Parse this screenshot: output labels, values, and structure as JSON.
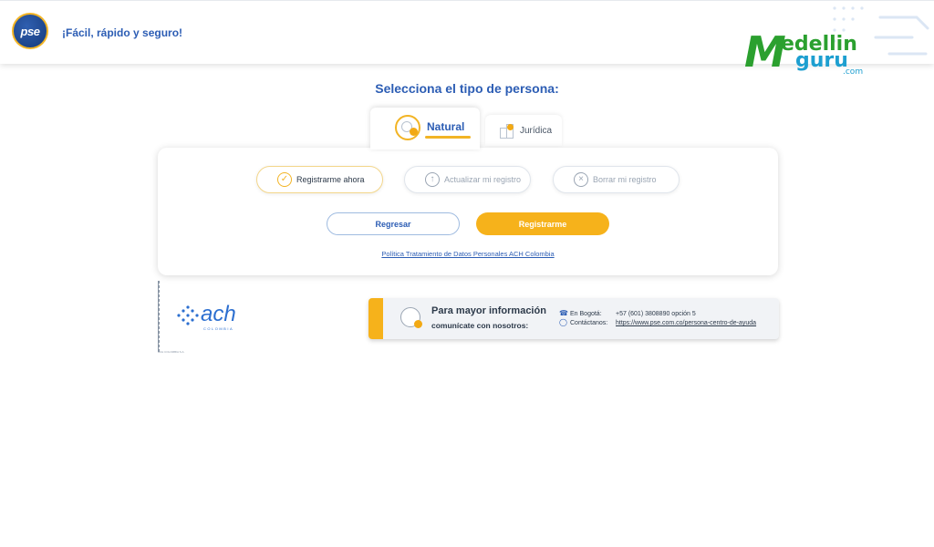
{
  "header": {
    "logo_text": "pse",
    "tagline": "¡Fácil, rápido y seguro!"
  },
  "watermark": {
    "part_m": "M",
    "part_edellin": "edellin",
    "part_guru": "guru",
    "part_com": ".com"
  },
  "main": {
    "title": "Selecciona el tipo de persona:",
    "tabs": [
      {
        "label": "Natural",
        "active": true
      },
      {
        "label": "Jurídica",
        "active": false
      }
    ],
    "options": [
      {
        "label": "Registrarme ahora",
        "icon": "check-circle-icon",
        "selected": true
      },
      {
        "label": "Actualizar mi registro",
        "icon": "arrow-up-circle-icon",
        "selected": false
      },
      {
        "label": "Borrar mi registro",
        "icon": "x-circle-icon",
        "selected": false
      }
    ],
    "buttons": {
      "back": "Regresar",
      "register": "Registrarme"
    },
    "policy_link": "Política Tratamiento de Datos Personales ACH Colombia"
  },
  "footer": {
    "ach_logo_text": "ach",
    "ach_logo_sub": "COLOMBIA",
    "side_caption": "ACH COLOMBIA S.A.",
    "info": {
      "title": "Para mayor información",
      "subtitle": "comunícate con nosotros:",
      "contacts": [
        {
          "key": "En Bogotá:",
          "value": "+57 (601) 3808890 opción 5",
          "icon": "phone-icon"
        },
        {
          "key": "Contáctanos:",
          "value": "https://www.pse.com.co/persona-centro-de-ayuda",
          "icon": "chat-icon"
        }
      ]
    }
  },
  "colors": {
    "brand_blue": "#2c5db4",
    "accent_yellow": "#f6b21b",
    "watermark_green": "#2ba02f",
    "watermark_blue": "#1d9fd0"
  }
}
